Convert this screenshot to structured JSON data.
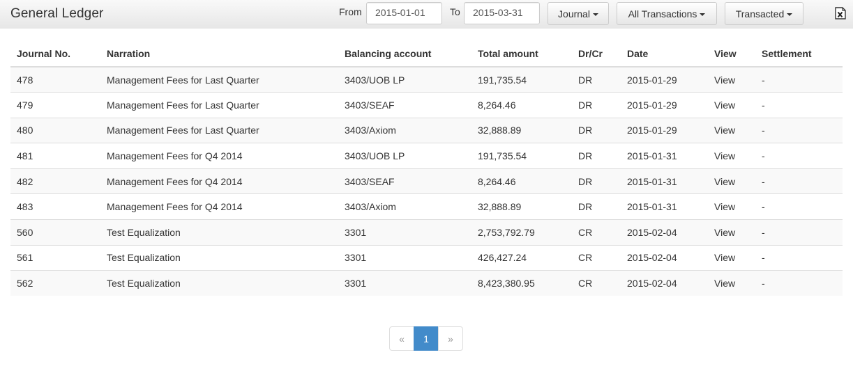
{
  "header": {
    "title": "General Ledger",
    "from_label": "From",
    "from_value": "2015-01-01",
    "to_label": "To",
    "to_value": "2015-03-31",
    "journal_label": "Journal",
    "transactions_label": "All Transactions",
    "transacted_label": "Transacted",
    "export_icon": "excel-file-icon"
  },
  "table": {
    "columns": [
      "Journal No.",
      "Narration",
      "Balancing account",
      "Total amount",
      "Dr/Cr",
      "Date",
      "View",
      "Settlement"
    ],
    "rows": [
      [
        "478",
        "Management Fees for Last Quarter",
        "3403/UOB LP",
        "191,735.54",
        "DR",
        "2015-01-29",
        "View",
        "-"
      ],
      [
        "479",
        "Management Fees for Last Quarter",
        "3403/SEAF",
        "8,264.46",
        "DR",
        "2015-01-29",
        "View",
        "-"
      ],
      [
        "480",
        "Management Fees for Last Quarter",
        "3403/Axiom",
        "32,888.89",
        "DR",
        "2015-01-29",
        "View",
        "-"
      ],
      [
        "481",
        "Management Fees for Q4 2014",
        "3403/UOB LP",
        "191,735.54",
        "DR",
        "2015-01-31",
        "View",
        "-"
      ],
      [
        "482",
        "Management Fees for Q4 2014",
        "3403/SEAF",
        "8,264.46",
        "DR",
        "2015-01-31",
        "View",
        "-"
      ],
      [
        "483",
        "Management Fees for Q4 2014",
        "3403/Axiom",
        "32,888.89",
        "DR",
        "2015-01-31",
        "View",
        "-"
      ],
      [
        "560",
        "Test Equalization",
        "3301",
        "2,753,792.79",
        "CR",
        "2015-02-04",
        "View",
        "-"
      ],
      [
        "561",
        "Test Equalization",
        "3301",
        "426,427.24",
        "CR",
        "2015-02-04",
        "View",
        "-"
      ],
      [
        "562",
        "Test Equalization",
        "3301",
        "8,423,380.95",
        "CR",
        "2015-02-04",
        "View",
        "-"
      ]
    ]
  },
  "pagination": {
    "prev": "«",
    "current": "1",
    "next": "»"
  },
  "colors": {
    "accent": "#428bca",
    "header_bg": "#e7e7e7",
    "stripe": "#f9f9f9"
  }
}
